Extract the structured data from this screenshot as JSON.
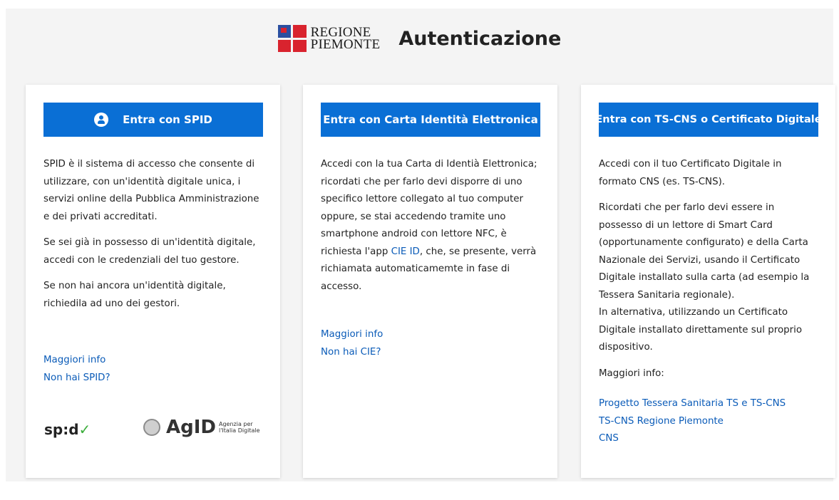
{
  "header": {
    "logo_line1": "REGIONE",
    "logo_line2": "PIEMONTE",
    "title": "Autenticazione"
  },
  "spid_card": {
    "button_label": "Entra con SPID",
    "paragraphs": [
      "SPID è il sistema di accesso che consente di utilizzare, con un'identità digitale unica, i servizi online della Pubblica Amministrazione e dei privati accreditati.",
      "Se sei già in possesso di un'identità digitale, accedi con le credenziali del tuo gestore.",
      "Se non hai ancora un'identità digitale, richiedila ad uno dei gestori."
    ],
    "links": [
      "Maggiori info",
      "Non hai SPID?"
    ],
    "logo_spid": "sp:d",
    "logo_agid": "AgID",
    "logo_agid_sub1": "Agenzia per",
    "logo_agid_sub2": "l'Italia Digitale"
  },
  "cie_card": {
    "button_label": "Entra con Carta Identità Elettronica",
    "text_before_link": "Accedi con la tua Carta di Identià Elettronica; ricordati che per farlo devi disporre di uno specifico lettore collegato al tuo computer oppure, se stai accedendo tramite uno smartphone android con lettore NFC, è richiesta l'app ",
    "app_link": "CIE ID",
    "text_after_link": ", che, se presente, verrà richiamata automaticamemte in fase di accesso.",
    "links": [
      "Maggiori info",
      "Non hai CIE?"
    ]
  },
  "cns_card": {
    "button_label": "Entra con TS-CNS o Certificato Digitale",
    "paragraph1": "Accedi con il tuo Certificato Digitale in formato CNS (es. TS-CNS).",
    "paragraph2": "Ricordati che per farlo devi essere in possesso di un lettore di Smart Card (opportunamente configurato) e della Carta Nazionale dei Servizi, usando il Certificato Digitale installato sulla carta (ad esempio la Tessera Sanitaria regionale).",
    "paragraph3": "In alternativa, utilizzando un Certificato Digitale installato direttamente sul proprio dispositivo.",
    "more_info_label": "Maggiori info:",
    "links": [
      "Progetto Tessera Sanitaria TS e TS-CNS",
      "TS-CNS Regione Piemonte",
      "CNS"
    ]
  },
  "colors": {
    "button_blue": "#0a6fd5",
    "link_blue": "#0a5bb8",
    "background": "#f4f4f4"
  }
}
